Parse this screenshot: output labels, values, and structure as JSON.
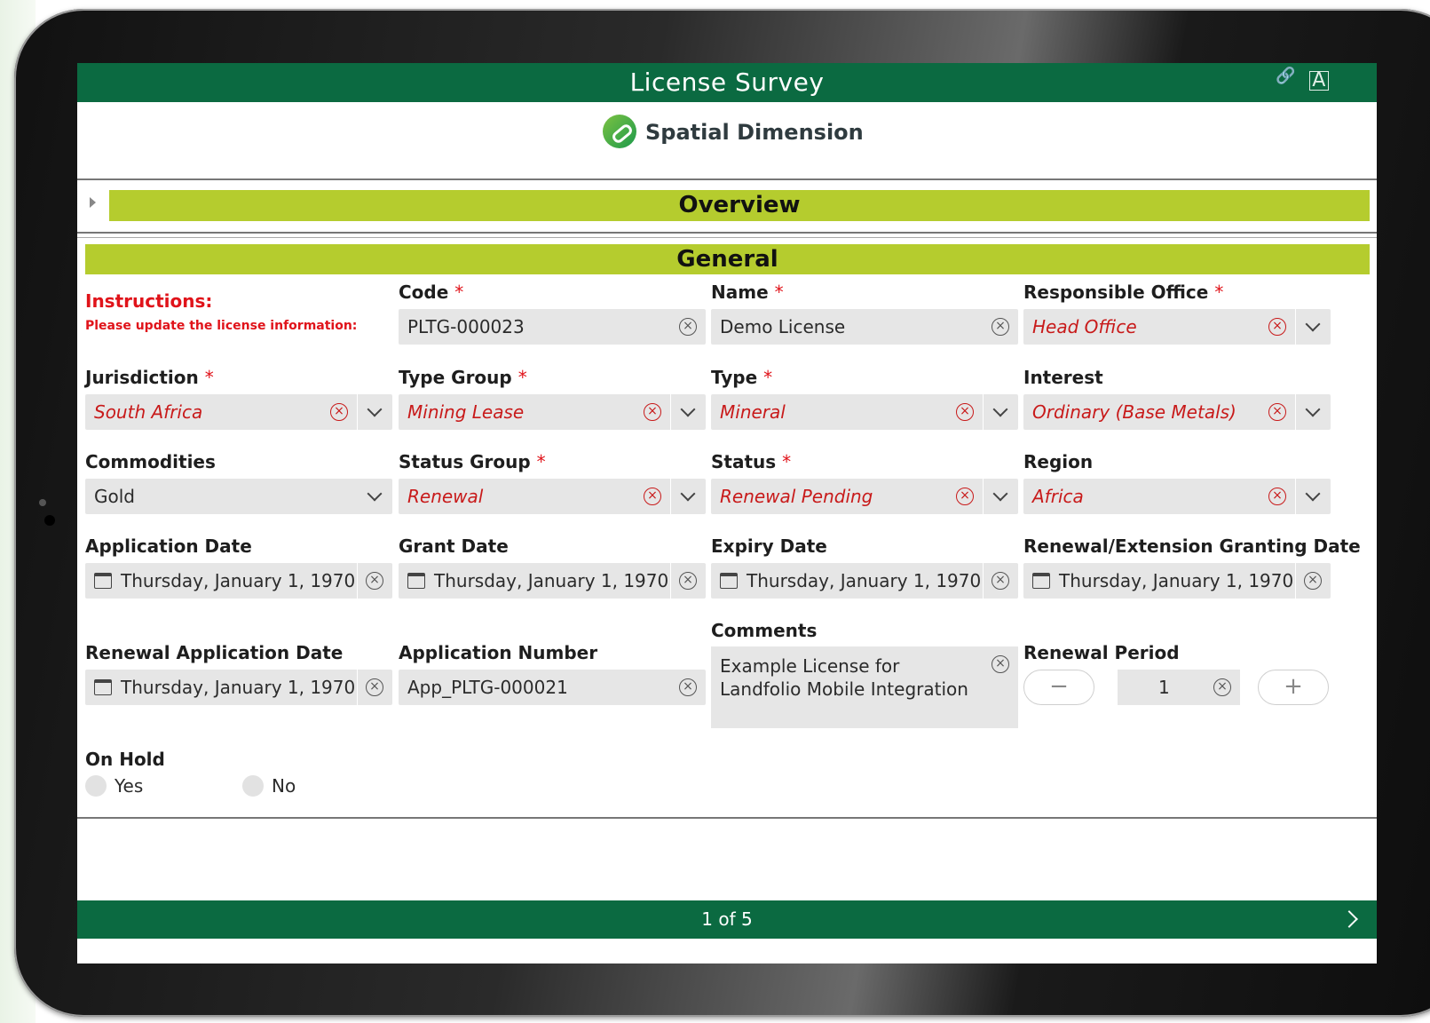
{
  "app": {
    "title": "License Survey",
    "brand": "Spatial Dimension",
    "header_icons": [
      "link-icon",
      "translate-icon"
    ]
  },
  "sections": {
    "overview": "Overview",
    "general": "General"
  },
  "instructions": {
    "title": "Instructions:",
    "text": "Please update the license information:"
  },
  "fields": {
    "code": {
      "label": "Code",
      "required": "*",
      "value": "PLTG-000023"
    },
    "name": {
      "label": "Name",
      "required": "*",
      "value": "Demo License"
    },
    "responsible_office": {
      "label": "Responsible Office",
      "required": "*",
      "value": "Head Office"
    },
    "jurisdiction": {
      "label": "Jurisdiction",
      "required": "*",
      "value": "South Africa"
    },
    "type_group": {
      "label": "Type Group",
      "required": "*",
      "value": "Mining Lease"
    },
    "type": {
      "label": "Type",
      "required": "*",
      "value": "Mineral"
    },
    "interest": {
      "label": "Interest",
      "value": "Ordinary (Base Metals)"
    },
    "commodities": {
      "label": "Commodities",
      "value": "Gold"
    },
    "status_group": {
      "label": "Status Group",
      "required": "*",
      "value": "Renewal"
    },
    "status": {
      "label": "Status",
      "required": "*",
      "value": "Renewal Pending"
    },
    "region": {
      "label": "Region",
      "value": "Africa"
    },
    "application_date": {
      "label": "Application Date",
      "value": "Thursday, January 1, 1970"
    },
    "grant_date": {
      "label": "Grant Date",
      "value": "Thursday, January 1, 1970"
    },
    "expiry_date": {
      "label": "Expiry Date",
      "value": "Thursday, January 1, 1970"
    },
    "renewal_granting_date": {
      "label": "Renewal/Extension Granting Date",
      "value": "Thursday, January 1, 1970"
    },
    "renewal_application_date": {
      "label": "Renewal Application Date",
      "value": "Thursday, January 1, 1970"
    },
    "application_number": {
      "label": "Application Number",
      "value": "App_PLTG-000021"
    },
    "comments": {
      "label": "Comments",
      "value": "Example License for Landfolio Mobile Integration"
    },
    "renewal_period": {
      "label": "Renewal Period",
      "value": "1",
      "minus": "−",
      "plus": "+"
    },
    "on_hold": {
      "label": "On Hold",
      "options": [
        "Yes",
        "No"
      ]
    }
  },
  "footer": {
    "page": "1 of 5"
  },
  "colors": {
    "header_green": "#0b6a41",
    "section_lime": "#b5cc2e",
    "required_red": "#e0131a"
  }
}
